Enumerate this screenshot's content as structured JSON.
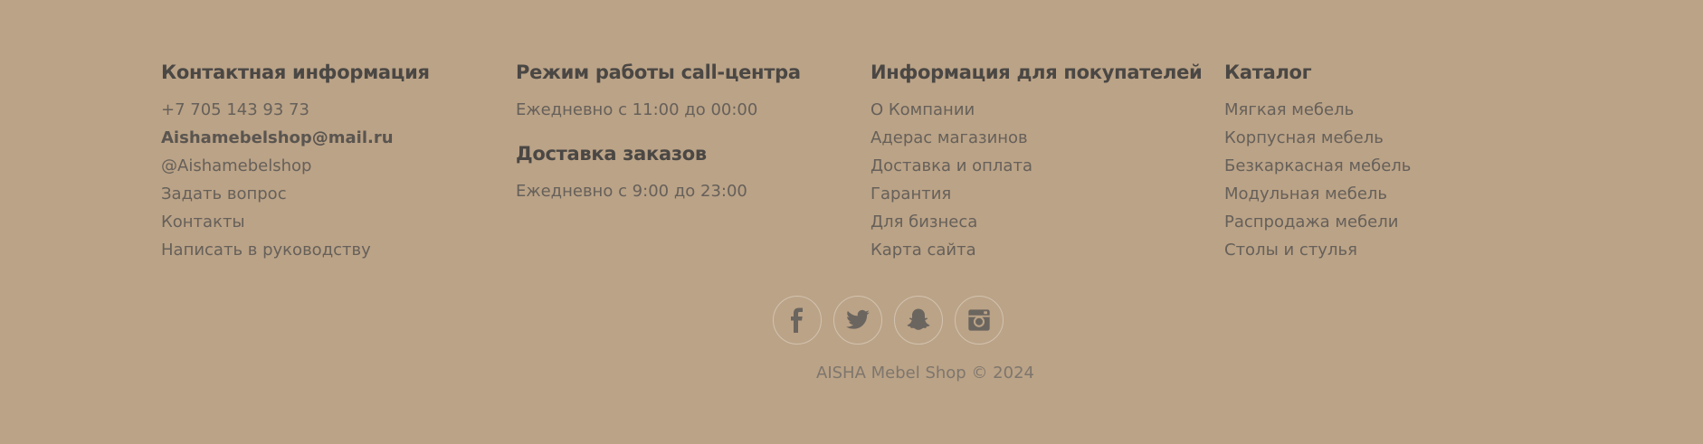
{
  "footer": {
    "contacts": {
      "title": "Контактная информация",
      "phone": "+7 705 143 93 73",
      "email": "Aishamebelshop@mail.ru",
      "handle": "@Aishamebelshop",
      "ask": "Задать вопрос",
      "contacts": "Контакты",
      "write_management": "Написать в руководству"
    },
    "callcenter": {
      "title": "Режим работы call-центра",
      "hours": "Ежедневно с 11:00 до 00:00",
      "delivery_title": "Доставка заказов",
      "delivery_hours": "Ежедневно с 9:00 до 23:00"
    },
    "buyers": {
      "title": "Информация для покупателей",
      "items": [
        "О Компании",
        "Адерас магазинов",
        "Доставка и оплата",
        "Гарантия",
        "Для бизнеса",
        "Карта сайта"
      ]
    },
    "catalog": {
      "title": "Каталог",
      "items": [
        "Мягкая мебель",
        "Корпусная мебель",
        "Безкаркасная мебель",
        "Модульная мебель",
        "Распродажа мебели",
        "Столы и стулья"
      ]
    },
    "socials": [
      "facebook-icon",
      "twitter-icon",
      "snapchat-icon",
      "instagram-icon"
    ],
    "copyright": "AISHA Mebel Shop © 2024"
  },
  "colors": {
    "background": "#bba387",
    "heading": "#4a4744",
    "link": "#66605a",
    "icon": "#6b655f",
    "icon_border": "#d3c3b0"
  }
}
